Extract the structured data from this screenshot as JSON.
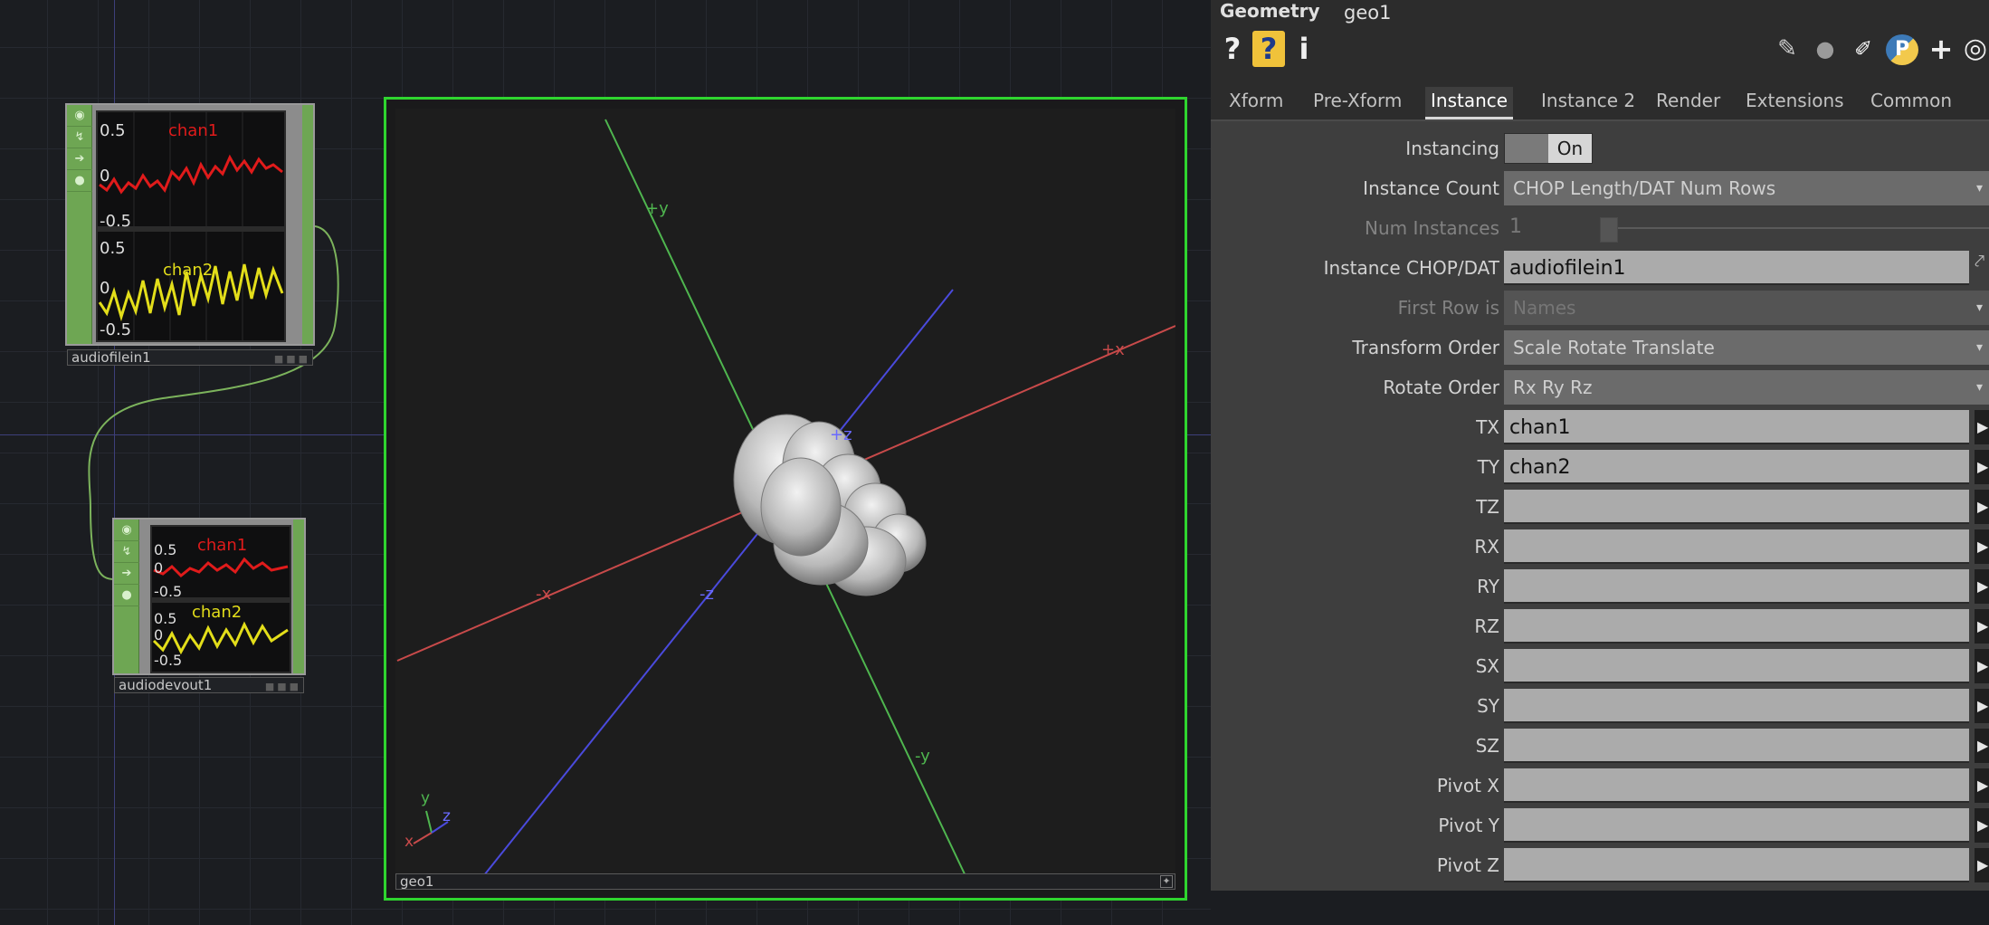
{
  "network": {
    "audiofilein": {
      "name": "audiofilein1",
      "ch1": {
        "name": "chan1",
        "tick_top": "0.5",
        "tick_mid": "0",
        "tick_bot": "-0.5"
      },
      "ch2": {
        "name": "chan2",
        "tick_top": "0.5",
        "tick_mid": "0",
        "tick_bot": "-0.5"
      }
    },
    "audiodevout": {
      "name": "audiodevout1",
      "ch1": {
        "name": "chan1",
        "tick_top": "0.5",
        "tick_mid": "0",
        "tick_bot": "-0.5"
      },
      "ch2": {
        "name": "chan2",
        "tick_top": "0.5",
        "tick_mid": "0",
        "tick_bot": "-0.5"
      }
    },
    "geo": {
      "name": "geo1",
      "axes": {
        "plus_y": "+y",
        "minus_y": "-y",
        "plus_x": "+x",
        "minus_x": "-x",
        "plus_z": "+z",
        "minus_z": "-z"
      },
      "gizmo": {
        "x": "x",
        "y": "y",
        "z": "z"
      }
    }
  },
  "params": {
    "header": {
      "type": "Geometry",
      "name": "geo1"
    },
    "toolbar": {
      "help": "?",
      "help_op": "?",
      "info": "i",
      "add": "+"
    },
    "tabs": [
      "Xform",
      "Pre-Xform",
      "Instance",
      "Instance 2",
      "Render",
      "Extensions",
      "Common"
    ],
    "active_tab": "Instance",
    "rows": {
      "instancing": {
        "label": "Instancing",
        "value": "On"
      },
      "instance_count": {
        "label": "Instance Count",
        "value": "CHOP Length/DAT Num Rows"
      },
      "num_instances": {
        "label": "Num Instances",
        "value": "1"
      },
      "instance_chop": {
        "label": "Instance CHOP/DAT",
        "value": "audiofilein1"
      },
      "first_row": {
        "label": "First Row is",
        "value": "Names"
      },
      "transform_order": {
        "label": "Transform Order",
        "value": "Scale Rotate Translate"
      },
      "rotate_order": {
        "label": "Rotate Order",
        "value": "Rx Ry Rz"
      },
      "tx": {
        "label": "TX",
        "value": "chan1"
      },
      "ty": {
        "label": "TY",
        "value": "chan2"
      },
      "tz": {
        "label": "TZ",
        "value": ""
      },
      "rx": {
        "label": "RX",
        "value": ""
      },
      "ry": {
        "label": "RY",
        "value": ""
      },
      "rz": {
        "label": "RZ",
        "value": ""
      },
      "sx": {
        "label": "SX",
        "value": ""
      },
      "sy": {
        "label": "SY",
        "value": ""
      },
      "sz": {
        "label": "SZ",
        "value": ""
      },
      "pivot_x": {
        "label": "Pivot X",
        "value": ""
      },
      "pivot_y": {
        "label": "Pivot Y",
        "value": ""
      },
      "pivot_z": {
        "label": "Pivot Z",
        "value": ""
      }
    }
  },
  "colors": {
    "ch1": "#e01b1b",
    "ch2": "#e3de1a",
    "geo_border": "#2fd52f",
    "chop_green": "#6ea653"
  }
}
